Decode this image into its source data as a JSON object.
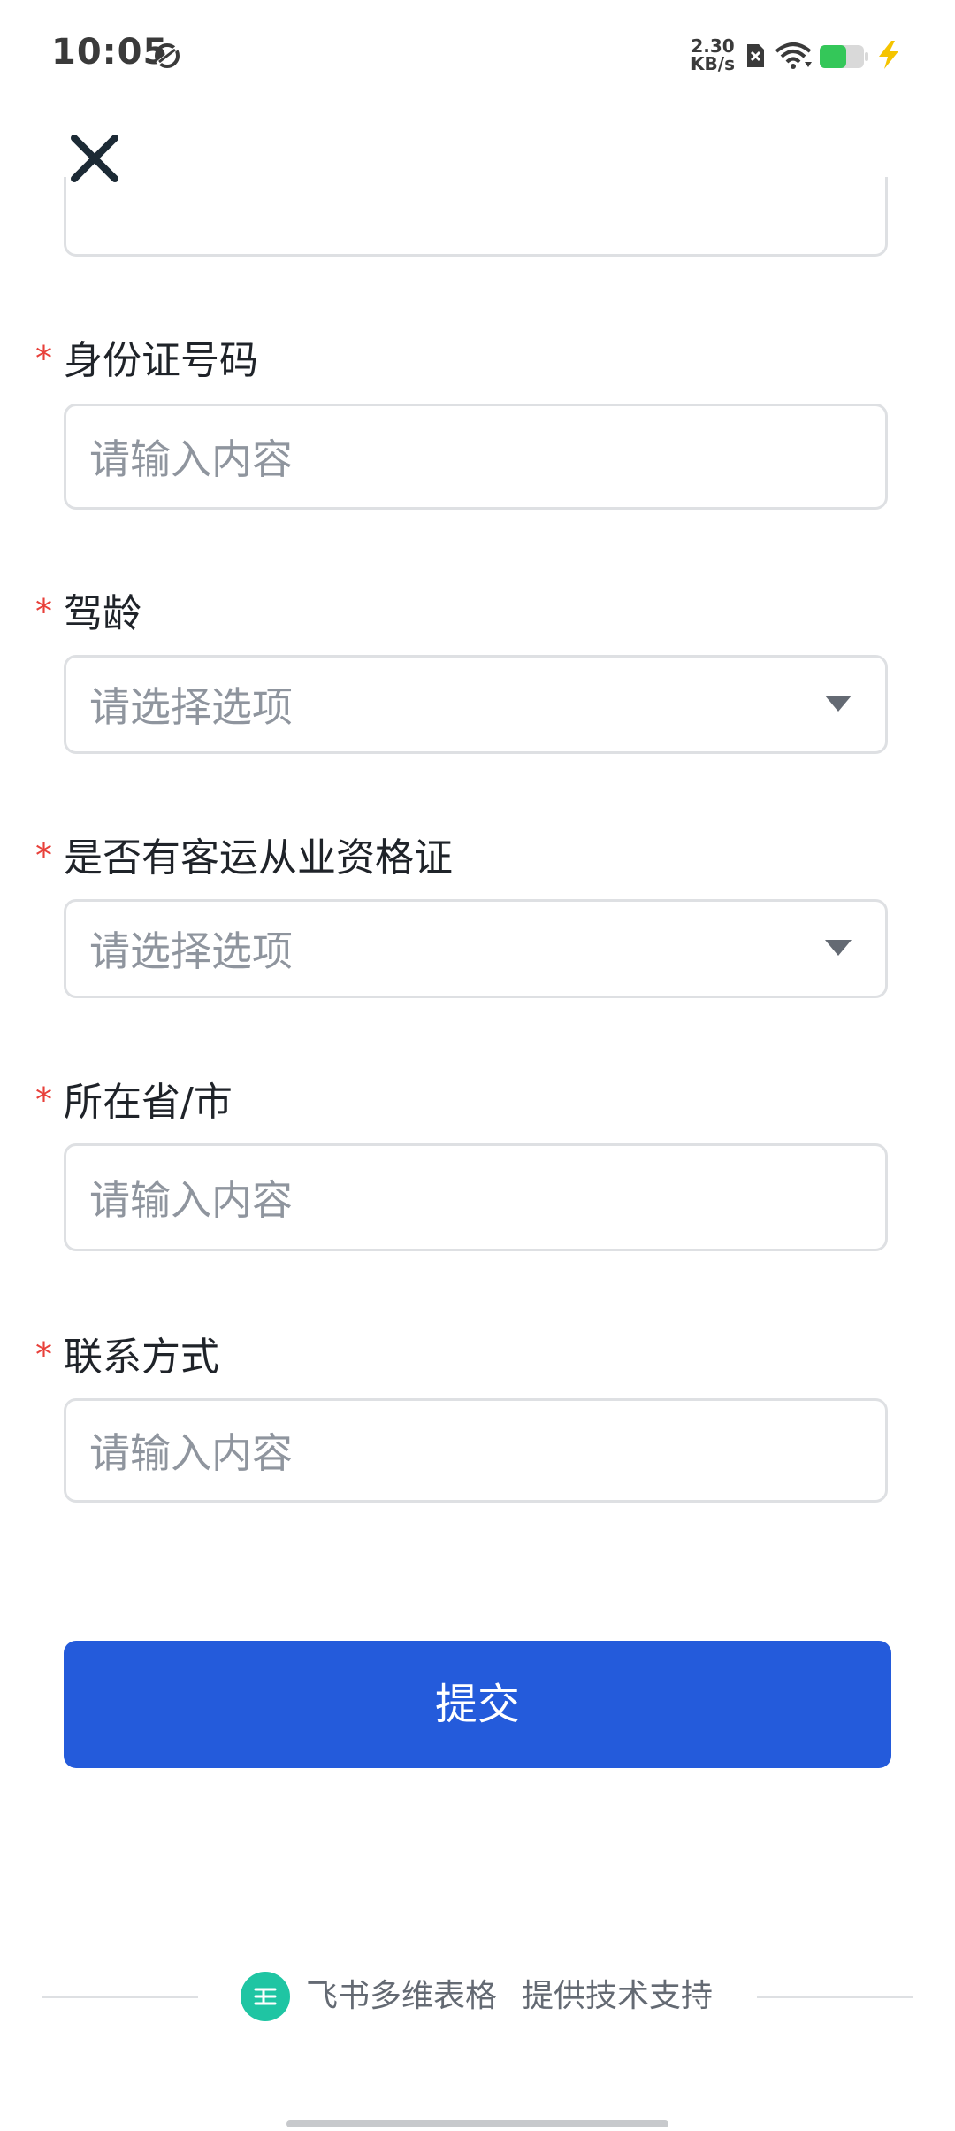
{
  "status_bar": {
    "time": "10:05",
    "net_speed_value": "2.30",
    "net_speed_unit": "KB/s",
    "icons": [
      "sync-icon",
      "sim-icon",
      "wifi-icon",
      "battery-icon",
      "charge-icon"
    ],
    "battery_level": 0.6
  },
  "header": {
    "close_icon": "close-icon"
  },
  "form": {
    "required_mark": "*",
    "fields": [
      {
        "label": "身份证号码",
        "type": "input",
        "placeholder": "请输入内容"
      },
      {
        "label": "驾龄",
        "type": "select",
        "placeholder": "请选择选项"
      },
      {
        "label": "是否有客运从业资格证",
        "type": "select",
        "placeholder": "请选择选项"
      },
      {
        "label": "所在省/市",
        "type": "input",
        "placeholder": "请输入内容"
      },
      {
        "label": "联系方式",
        "type": "input",
        "placeholder": "请输入内容"
      }
    ],
    "submit_label": "提交"
  },
  "footer": {
    "brand": "飞书多维表格",
    "support_text": "提供技术支持"
  },
  "colors": {
    "accent": "#245bdb",
    "required": "#e8403a",
    "border": "#dee0e3",
    "placeholder": "#8f959e",
    "footer_logo": "#1fc5a3",
    "battery": "#34c759",
    "charge": "#f5c400"
  }
}
